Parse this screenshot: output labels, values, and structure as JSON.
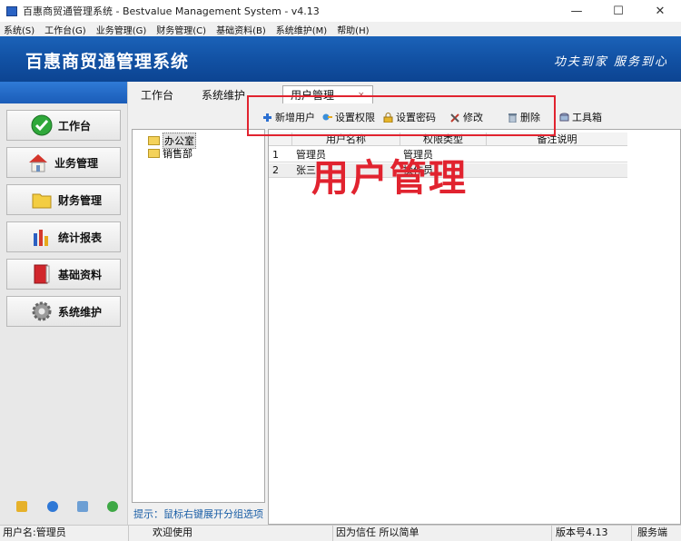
{
  "window": {
    "title": "百惠商贸通管理系统 - Bestvalue Management System - v4.13",
    "controls": [
      "—",
      "☐",
      "✕"
    ]
  },
  "menu": [
    "系统(S)",
    "工作台(G)",
    "业务管理(G)",
    "财务管理(C)",
    "基础资料(B)",
    "系统维护(M)",
    "帮助(H)"
  ],
  "banner": {
    "title": "百惠商贸通管理系统",
    "slogan": "功夫到家 服务到心"
  },
  "leftnav": {
    "items": [
      {
        "label": "工作台",
        "icon": "check-icon"
      },
      {
        "label": "业务管理",
        "icon": "house-icon"
      },
      {
        "label": "财务管理",
        "icon": "folder-icon"
      },
      {
        "label": "统计报表",
        "icon": "bar-chart-icon"
      },
      {
        "label": "基础资料",
        "icon": "book-icon"
      },
      {
        "label": "系统维护",
        "icon": "gear-icon"
      }
    ]
  },
  "tabs": [
    {
      "label": "工作台"
    },
    {
      "label": "系统维护"
    },
    {
      "label": "用户管理",
      "close": "×"
    }
  ],
  "toolbar": {
    "items": [
      {
        "label": "新增用户",
        "icon": "plus-icon"
      },
      {
        "label": "设置权限",
        "icon": "key-icon"
      },
      {
        "label": "设置密码",
        "icon": "lock-icon"
      },
      {
        "label": "修改",
        "icon": "edit-icon"
      },
      {
        "label": "删除",
        "icon": "trash-icon"
      },
      {
        "label": "工具箱",
        "icon": "toolbox-icon"
      }
    ]
  },
  "tree": {
    "nodes": [
      {
        "label": "办公室",
        "selected": true
      },
      {
        "label": "销售部",
        "selected": false
      }
    ]
  },
  "hint": "提示：鼠标右键展开分组选项",
  "grid": {
    "columns": [
      "",
      "用户名称",
      "权限类型",
      "备注说明"
    ],
    "rows": [
      {
        "no": "1",
        "name": "管理员",
        "role": "管理员",
        "note": ""
      },
      {
        "no": "2",
        "name": "张三",
        "role": "操作员",
        "note": ""
      }
    ]
  },
  "annotation": {
    "text": "用户管理",
    "color": "#e1232f"
  },
  "status": {
    "user": "用户名:管理员",
    "welcome": "欢迎使用",
    "motto": "因为信任 所以简单",
    "version": "版本号4.13",
    "server": "服务端"
  },
  "colors": {
    "banner": "#1150a2",
    "hint": "#1a5ea6",
    "accent_red": "#e1232f"
  }
}
